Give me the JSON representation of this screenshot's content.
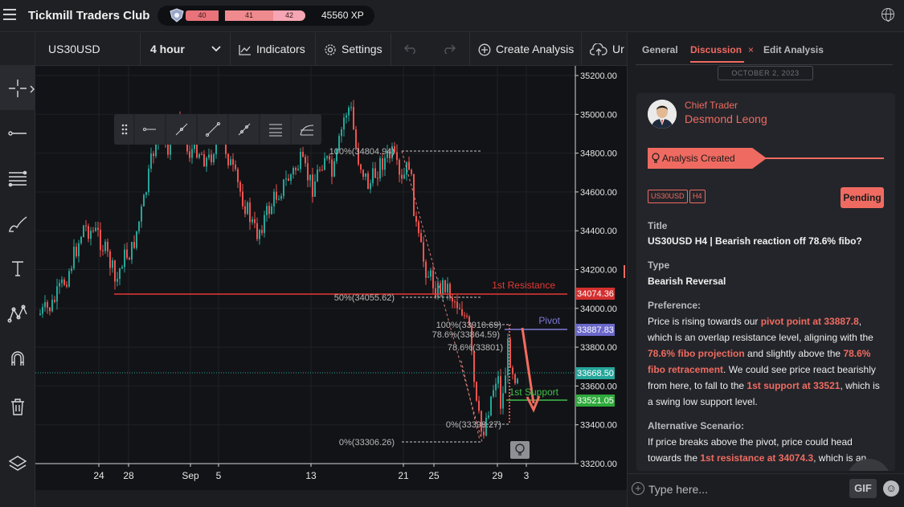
{
  "app": {
    "brand": "Tickmill Traders Club",
    "xp": "45560 XP",
    "levels": [
      "40",
      "41",
      "42"
    ]
  },
  "toolbar": {
    "symbol": "US30USD",
    "interval": "4 hour",
    "indicators": "Indicators",
    "settings": "Settings",
    "create_analysis": "Create Analysis",
    "upload": "Ur"
  },
  "chart": {
    "price_axis": [
      "35200.00",
      "35000.00",
      "34800.00",
      "34600.00",
      "34400.00",
      "34200.00",
      "34000.00",
      "33800.00",
      "33600.00",
      "33400.00",
      "33200.00"
    ],
    "time_axis": [
      "24",
      "28",
      "Sep",
      "5",
      "13",
      "21",
      "25",
      "29",
      "3"
    ],
    "fib_labels": [
      "100%(34804.94)",
      "50%(34055.62)",
      "0%(33306.26)",
      "100%(33910.69)",
      "78.6%(33864.59)",
      "78.6%(33801)",
      "0%(33398.27)"
    ],
    "levels": {
      "resistance": {
        "label": "1st Resistance",
        "price_tag": "34074.36"
      },
      "pivot": {
        "label": "Pivot",
        "price_tag": "33887.83"
      },
      "current": {
        "price_tag": "33668.50"
      },
      "support": {
        "label": "1st Support",
        "price_tag": "33521.05"
      }
    },
    "colors": {
      "up": "#26a69a",
      "down": "#ef5350",
      "resistance": "#e53935",
      "pivot": "#7e7bd6",
      "support": "#3fbf4a",
      "current": "#26a69a"
    }
  },
  "panel": {
    "tabs": [
      {
        "label": "General"
      },
      {
        "label": "Discussion",
        "close": "×"
      },
      {
        "label": "Edit Analysis"
      }
    ],
    "date": "OCTOBER 2, 2023",
    "author_role": "Chief Trader",
    "author_name": "Desmond Leong",
    "banner": "Analysis Created",
    "tags": [
      "US30USD",
      "H4"
    ],
    "status": "Pending",
    "title_label": "Title",
    "title_value": "US30USD H4 | Bearish reaction off 78.6% fibo?",
    "type_label": "Type",
    "type_value": "Bearish Reversal",
    "pref_label": "Preference:",
    "pref": {
      "t1": "Price is rising towards our ",
      "h1": "pivot point at 33887.8",
      "t2": ", which is an overlap resistance level, aligning with the ",
      "h2": "78.6% fibo projection",
      "t3": " and slightly above the ",
      "h3": "78.6% fibo retracement",
      "t4": ". We could see price react bearishly from here, to fall to the ",
      "h4": "1st support at 33521",
      "t5": ", which is a swing low support level."
    },
    "alt_label": "Alternative Scenario:",
    "alt": {
      "t1": "If price breaks above the pivot, price could head towards the ",
      "h1": "1st resistance at 34074.3",
      "t2": ", which is an"
    },
    "input_placeholder": "Type here...",
    "gif": "GIF"
  }
}
